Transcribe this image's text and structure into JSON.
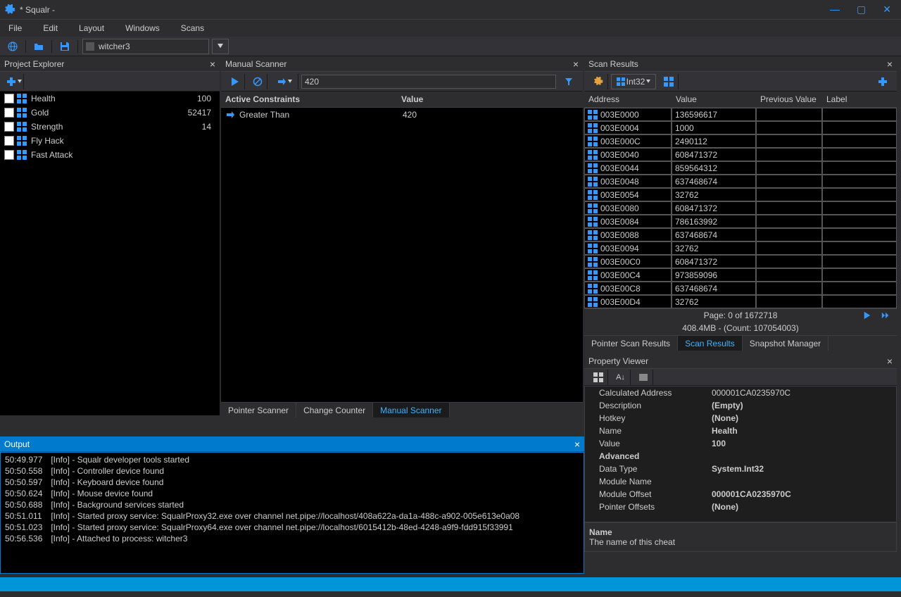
{
  "window": {
    "title": "* Squalr -"
  },
  "menu": [
    "File",
    "Edit",
    "Layout",
    "Windows",
    "Scans"
  ],
  "process": "witcher3",
  "project_explorer": {
    "title": "Project Explorer",
    "items": [
      {
        "name": "Health",
        "value": "100"
      },
      {
        "name": "Gold",
        "value": "52417"
      },
      {
        "name": "Strength",
        "value": "14"
      },
      {
        "name": "Fly Hack",
        "value": ""
      },
      {
        "name": "Fast Attack",
        "value": ""
      }
    ]
  },
  "manual_scanner": {
    "title": "Manual Scanner",
    "input_value": "420",
    "headers": {
      "constraints": "Active Constraints",
      "value": "Value"
    },
    "constraint": {
      "label": "Greater Than",
      "value": "420"
    },
    "tabs": [
      "Pointer Scanner",
      "Change Counter",
      "Manual Scanner"
    ],
    "active_tab": 2
  },
  "output": {
    "title": "Output",
    "lines": [
      {
        "ts": "50:49.977",
        "msg": "[Info] - Squalr developer tools started"
      },
      {
        "ts": "50:50.558",
        "msg": "[Info] - Controller device found"
      },
      {
        "ts": "50:50.597",
        "msg": "[Info] - Keyboard device found"
      },
      {
        "ts": "50:50.624",
        "msg": "[Info] - Mouse device found"
      },
      {
        "ts": "50:50.688",
        "msg": "[Info] - Background services started"
      },
      {
        "ts": "50:51.011",
        "msg": "[Info] - Started proxy service: SqualrProxy32.exe over channel net.pipe://localhost/408a622a-da1a-488c-a902-005e613e0a08"
      },
      {
        "ts": "50:51.023",
        "msg": "[Info] - Started proxy service: SqualrProxy64.exe over channel net.pipe://localhost/6015412b-48ed-4248-a9f9-fdd915f33991"
      },
      {
        "ts": "50:56.536",
        "msg": "[Info] - Attached to process: witcher3"
      }
    ]
  },
  "scan_results": {
    "title": "Scan Results",
    "type_label": "Int32",
    "headers": [
      "Address",
      "Value",
      "Previous Value",
      "Label"
    ],
    "rows": [
      {
        "addr": "003E0000",
        "val": "136596617"
      },
      {
        "addr": "003E0004",
        "val": "1000"
      },
      {
        "addr": "003E000C",
        "val": "2490112"
      },
      {
        "addr": "003E0040",
        "val": "608471372"
      },
      {
        "addr": "003E0044",
        "val": "859564312"
      },
      {
        "addr": "003E0048",
        "val": "637468674"
      },
      {
        "addr": "003E0054",
        "val": "32762"
      },
      {
        "addr": "003E0080",
        "val": "608471372"
      },
      {
        "addr": "003E0084",
        "val": "786163992"
      },
      {
        "addr": "003E0088",
        "val": "637468674"
      },
      {
        "addr": "003E0094",
        "val": "32762"
      },
      {
        "addr": "003E00C0",
        "val": "608471372"
      },
      {
        "addr": "003E00C4",
        "val": "973859096"
      },
      {
        "addr": "003E00C8",
        "val": "637468674"
      },
      {
        "addr": "003E00D4",
        "val": "32762"
      }
    ],
    "page_info": "Page: 0 of 1672718",
    "status": "408.4MB - (Count: 107054003)",
    "tabs": [
      "Pointer Scan Results",
      "Scan Results",
      "Snapshot Manager"
    ],
    "active_tab": 1
  },
  "property_viewer": {
    "title": "Property Viewer",
    "rows": [
      {
        "k": "Calculated Address",
        "v": "000001CA0235970C",
        "bold": false
      },
      {
        "k": "Description",
        "v": "(Empty)",
        "bold": true
      },
      {
        "k": "Hotkey",
        "v": "(None)",
        "bold": true
      },
      {
        "k": "Name",
        "v": "Health",
        "bold": true
      },
      {
        "k": "Value",
        "v": "100",
        "bold": true
      }
    ],
    "category": "Advanced",
    "advanced": [
      {
        "k": "Data Type",
        "v": "System.Int32",
        "bold": true
      },
      {
        "k": "Module Name",
        "v": "",
        "bold": false
      },
      {
        "k": "Module Offset",
        "v": "000001CA0235970C",
        "bold": true
      },
      {
        "k": "Pointer Offsets",
        "v": "(None)",
        "bold": true
      }
    ],
    "desc": {
      "name": "Name",
      "text": "The name of this cheat"
    }
  }
}
